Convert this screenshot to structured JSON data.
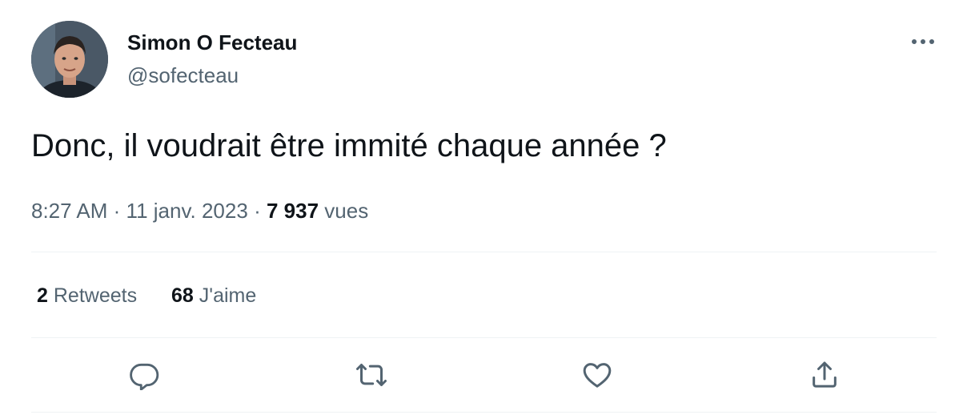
{
  "author": {
    "name": "Simon O Fecteau",
    "handle": "@sofecteau"
  },
  "tweet": {
    "text": "Donc, il voudrait être immité chaque année ?",
    "time": "8:27 AM",
    "date": "11 janv. 2023",
    "separator": "·",
    "views_count": "7 937",
    "views_label": "vues"
  },
  "stats": {
    "retweets_count": "2",
    "retweets_label": "Retweets",
    "likes_count": "68",
    "likes_label": "J'aime"
  },
  "icons": {
    "more": "more-horizontal-icon",
    "reply": "reply-icon",
    "retweet": "retweet-icon",
    "like": "heart-icon",
    "share": "share-icon"
  },
  "colors": {
    "text_primary": "#0f1419",
    "text_secondary": "#536471",
    "divider": "#eff3f4"
  }
}
